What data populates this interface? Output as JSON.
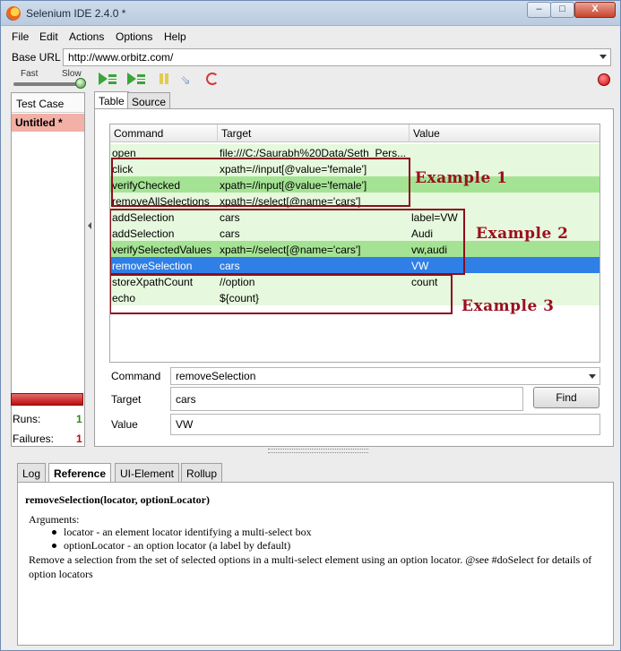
{
  "window": {
    "title": "Selenium IDE 2.4.0 *",
    "controls": {
      "minimize": "–",
      "maximize": "□",
      "close": "X"
    }
  },
  "menu": [
    "File",
    "Edit",
    "Actions",
    "Options",
    "Help"
  ],
  "base_url": {
    "label": "Base URL",
    "value": "http://www.orbitz.com/"
  },
  "toolbar": {
    "fast_label": "Fast",
    "slow_label": "Slow",
    "step_glyph": "⇘"
  },
  "test_case_panel": {
    "header": "Test Case",
    "items": [
      "Untitled *"
    ],
    "runs_label": "Runs:",
    "runs_value": "1",
    "failures_label": "Failures:",
    "failures_value": "1"
  },
  "editor_tabs": [
    "Table",
    "Source"
  ],
  "table": {
    "columns": [
      "Command",
      "Target",
      "Value"
    ],
    "rows": [
      {
        "command": "open",
        "target": "file:///C:/Saurabh%20Data/Seth_Pers...",
        "value": "",
        "state": "light"
      },
      {
        "command": "click",
        "target": "xpath=//input[@value='female']",
        "value": "",
        "state": "light"
      },
      {
        "command": "verifyChecked",
        "target": "xpath=//input[@value='female']",
        "value": "",
        "state": "passed"
      },
      {
        "command": "removeAllSelections",
        "target": "xpath=//select[@name='cars']",
        "value": "",
        "state": "light"
      },
      {
        "command": "addSelection",
        "target": "cars",
        "value": "label=VW",
        "state": "light"
      },
      {
        "command": "addSelection",
        "target": "cars",
        "value": "Audi",
        "state": "light"
      },
      {
        "command": "verifySelectedValues",
        "target": "xpath=//select[@name='cars']",
        "value": "vw,audi",
        "state": "passed"
      },
      {
        "command": "removeSelection",
        "target": "cars",
        "value": "VW",
        "state": "selected"
      },
      {
        "command": "storeXpathCount",
        "target": "//option",
        "value": "count",
        "state": "light"
      },
      {
        "command": "echo",
        "target": "${count}",
        "value": "",
        "state": "light"
      }
    ]
  },
  "annotations": [
    "Example 1",
    "Example 2",
    "Example 3"
  ],
  "form": {
    "command_label": "Command",
    "command_value": "removeSelection",
    "target_label": "Target",
    "target_value": "cars",
    "value_label": "Value",
    "value_value": "VW",
    "find_button": "Find"
  },
  "bottom_tabs": [
    "Log",
    "Reference",
    "UI-Element",
    "Rollup"
  ],
  "reference": {
    "signature": "removeSelection(locator, optionLocator)",
    "arguments_heading": "Arguments:",
    "args": [
      "locator - an element locator identifying a multi-select box",
      "optionLocator - an option locator (a label by default)"
    ],
    "description": "Remove a selection from the set of selected options in a multi-select element using an option locator. @see #doSelect for details of option locators"
  },
  "colors": {
    "row_light": "#e6f8dd",
    "row_passed": "#a5e394",
    "row_selected": "#2f7fe6",
    "annotation": "#8b0e1b",
    "failure_bar": "#c01a1a"
  }
}
